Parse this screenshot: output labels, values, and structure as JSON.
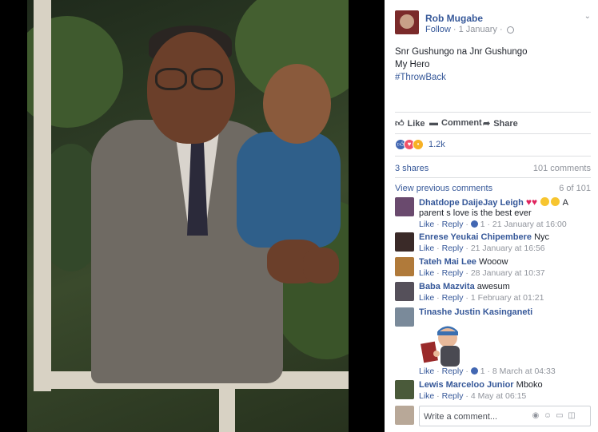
{
  "post": {
    "author": "Rob Mugabe",
    "follow": "Follow",
    "dot": " · ",
    "date": "1 January",
    "text_line1": "Snr Gushungo na Jnr Gushungo",
    "text_line2": "My Hero",
    "hashtag": "#ThrowBack"
  },
  "actions": {
    "like": "Like",
    "comment": "Comment",
    "share": "Share"
  },
  "reactions": {
    "count": "1.2k"
  },
  "stats": {
    "shares": "3 shares",
    "comments": "101 comments"
  },
  "comments_header": {
    "view_previous": "View previous comments",
    "range": "6 of 101"
  },
  "comments": [
    {
      "name": "Dhatdope DaijeJay Leigh",
      "text_after": "A parent s love is the best ever",
      "like": "Like",
      "reply": "Reply",
      "likes": "1",
      "time": "21 January at 16:00"
    },
    {
      "name": "Enrese Yeukai Chipembere",
      "text": "Nyc",
      "like": "Like",
      "reply": "Reply",
      "time": "21 January at 16:56"
    },
    {
      "name": "Tateh Mai Lee",
      "text": "Wooow",
      "like": "Like",
      "reply": "Reply",
      "time": "28 January at 10:37"
    },
    {
      "name": "Baba Mazvita",
      "text": "awesum",
      "like": "Like",
      "reply": "Reply",
      "time": "1 February at 01:21"
    },
    {
      "name": "Tinashe Justin Kasinganeti",
      "like": "Like",
      "reply": "Reply",
      "likes": "1",
      "time": "8 March at 04:33"
    },
    {
      "name": "Lewis Marceloo Junior",
      "text": "Mboko",
      "like": "Like",
      "reply": "Reply",
      "time": "4 May at 06:15"
    }
  ],
  "composer": {
    "placeholder": "Write a comment..."
  },
  "colors": {
    "link": "#365899",
    "muted": "#90949c",
    "like_blue": "#4267b2"
  }
}
